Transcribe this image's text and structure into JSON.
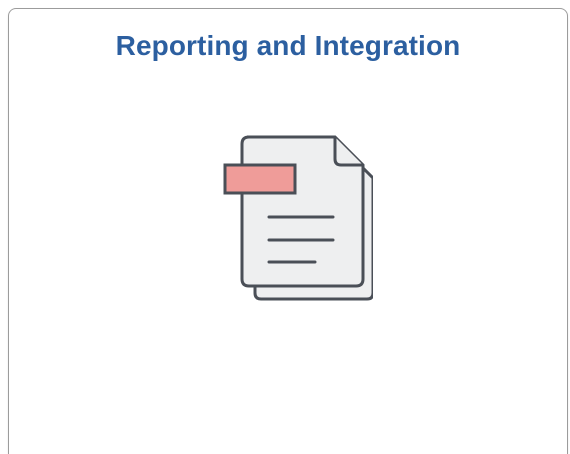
{
  "tile": {
    "title": "Reporting and Integration",
    "icon": "documents-icon",
    "colors": {
      "title": "#2c5fa0",
      "page_fill": "#eeeff0",
      "outline": "#4a4f57",
      "label_tab": "#ef9c99"
    }
  }
}
